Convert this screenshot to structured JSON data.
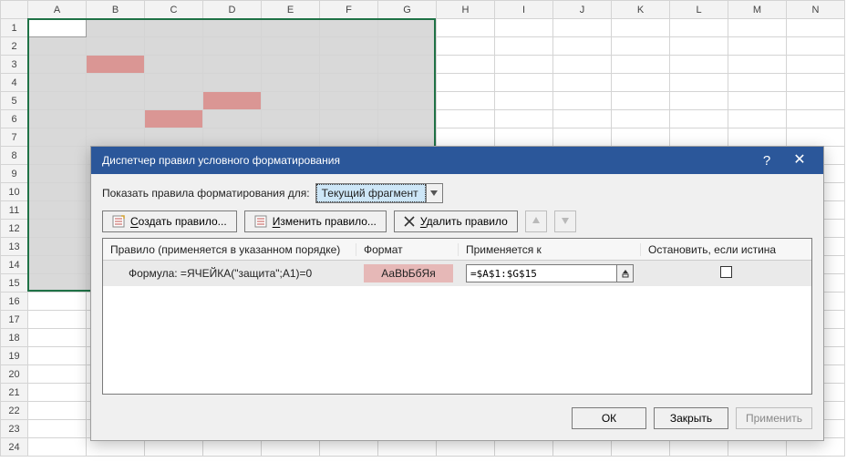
{
  "columns": [
    "A",
    "B",
    "C",
    "D",
    "E",
    "F",
    "G",
    "H",
    "I",
    "J",
    "K",
    "L",
    "M",
    "N"
  ],
  "row_count": 24,
  "selection": {
    "active": "A1",
    "range_cols": [
      "A",
      "G"
    ],
    "range_rows": [
      1,
      15
    ]
  },
  "pink_cells": [
    "B3",
    "C6",
    "D5"
  ],
  "dialog": {
    "title": "Диспетчер правил условного форматирования",
    "help_tooltip": "?",
    "close_tooltip": "×",
    "show_rules_label": "Показать правила форматирования для:",
    "scope_combo": {
      "selected": "Текущий фрагмент"
    },
    "toolbar": {
      "new_rule": "Создать правило...",
      "edit_rule": "Изменить правило...",
      "delete_rule": "Удалить правило"
    },
    "headers": {
      "rule": "Правило (применяется в указанном порядке)",
      "format": "Формат",
      "applies_to": "Применяется к",
      "stop_if_true": "Остановить, если истина"
    },
    "rule": {
      "label": "Формула: =ЯЧЕЙКА(\"защита\";A1)=0",
      "format_preview": "АаВbБбЯя",
      "range": "=$A$1:$G$15",
      "stop": false
    },
    "buttons": {
      "ok": "ОК",
      "close": "Закрыть",
      "apply": "Применить"
    }
  }
}
